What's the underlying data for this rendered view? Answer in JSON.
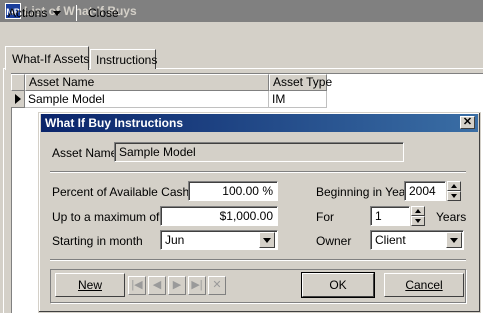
{
  "window": {
    "title": "List of What-If Buys",
    "icon_text": "MP"
  },
  "menu": {
    "actions": "Actions",
    "close": "Close"
  },
  "tabs": [
    {
      "label": "What-If Assets"
    },
    {
      "label": "Instructions"
    }
  ],
  "grid": {
    "columns": [
      "Asset Name",
      "Asset Type"
    ],
    "rows": [
      {
        "name": "Sample Model",
        "type": "IM"
      }
    ]
  },
  "dialog": {
    "title": "What If Buy Instructions",
    "asset_name_label": "Asset Name",
    "asset_name_value": "Sample Model",
    "percent_label": "Percent of Available Cash",
    "percent_value": "100.00 %",
    "max_label": "Up to a maximum of",
    "max_value": "$1,000.00",
    "start_month_label": "Starting in month",
    "start_month_value": "Jun",
    "begin_year_label": "Beginning in Year",
    "begin_year_value": "2004",
    "for_label": "For",
    "for_value": "1",
    "years_label": "Years",
    "owner_label": "Owner",
    "owner_value": "Client",
    "new_button": "New",
    "ok_button": "OK",
    "cancel_button": "Cancel",
    "nav": [
      "|◀",
      "◀",
      "▶",
      "▶|",
      "✕"
    ]
  }
}
